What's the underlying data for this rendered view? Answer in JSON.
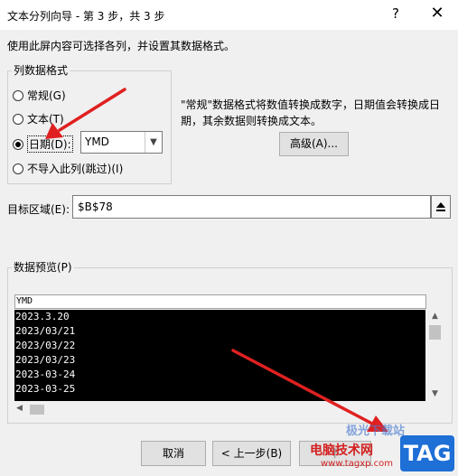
{
  "dialog": {
    "title": "文本分列向导 - 第 3 步，共 3 步",
    "help_glyph": "?",
    "close_glyph": "✕",
    "instruction": "使用此屏内容可选择各列，并设置其数据格式。"
  },
  "column_format": {
    "legend": "列数据格式",
    "options": [
      {
        "label": "常规(G)",
        "selected": false
      },
      {
        "label": "文本(T)",
        "selected": false
      },
      {
        "label": "日期(D):",
        "selected": true
      },
      {
        "label": "不导入此列(跳过)(I)",
        "selected": false
      }
    ],
    "date_format_value": "YMD",
    "description": "\"常规\"数据格式将数值转换成数字，日期值会转换成日期，其余数据则转换成文本。",
    "advanced_button": "高级(A)..."
  },
  "destination": {
    "label": "目标区域(E):",
    "value": "$B$78",
    "collapse_icon": "collapse-dialog-icon"
  },
  "preview": {
    "legend": "数据预览(P)",
    "header": "YMD",
    "rows": [
      "2023.3.20",
      "2023/03/21",
      "2023/03/22",
      "2023/03/23",
      "2023-03-24",
      "2023-03-25"
    ]
  },
  "buttons": {
    "cancel": "取消",
    "back": "< 上一步(B)",
    "next": "下"
  },
  "watermark": {
    "top_text": "极光下载站",
    "main_text": "电脑技术网",
    "url": "www.tagxp.com",
    "tag": "TAG"
  },
  "colors": {
    "annotation_arrow": "#e02020",
    "preview_selection_bg": "#000000",
    "watermark_tag_bg": "#1e6fd6"
  }
}
